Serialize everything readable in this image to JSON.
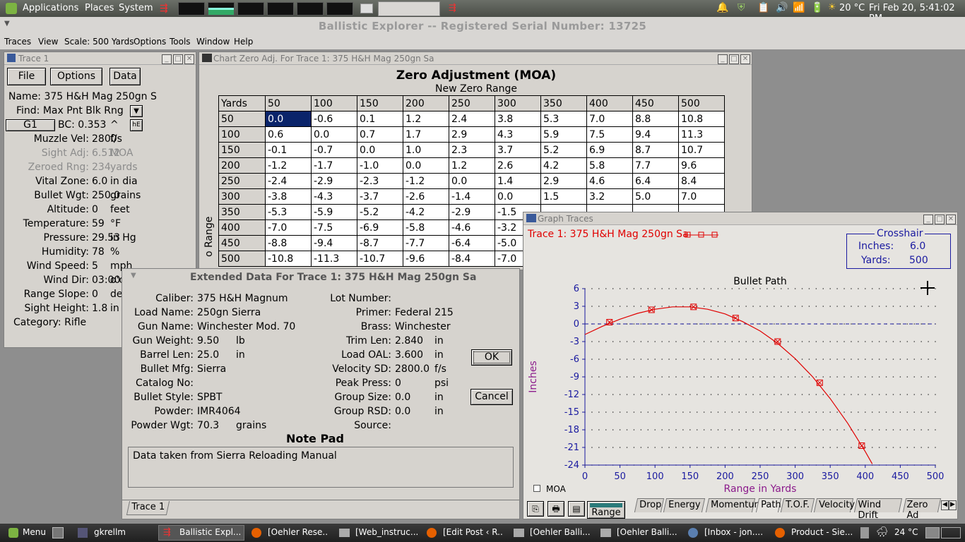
{
  "panel": {
    "applications": "Applications",
    "places": "Places",
    "system": "System",
    "temp": "20 °C",
    "clock": "Fri Feb 20,  5:41:02 PM"
  },
  "app": {
    "title": "Ballistic Explorer  --  Registered Serial Number: 13725",
    "menu": [
      "Traces",
      "View",
      "Scale: 500 Yards",
      "Options",
      "Tools",
      "Window",
      "Help"
    ]
  },
  "trace": {
    "title": "Trace 1",
    "file": "File",
    "options": "Options",
    "data": "Data",
    "name": "Name: 375 H&H Mag 250gn S",
    "find": "Find: Max Pnt Blk Rng",
    "g1": "G1",
    "bc": "BC: 0.353",
    "bc_unit": "^",
    "bc_btn": "hE",
    "fields": [
      {
        "label": "Muzzle Vel:",
        "value": "2800",
        "unit": "f/s",
        "grey": false
      },
      {
        "label": "Sight Adj:",
        "value": "6.512",
        "unit": "MOA",
        "grey": true
      },
      {
        "label": "Zeroed    Rng:",
        "value": "234",
        "unit": "yards",
        "grey": true
      },
      {
        "label": "Vital Zone:",
        "value": "6.0",
        "unit": "in dia",
        "grey": false
      },
      {
        "label": "Bullet Wgt:",
        "value": "250.0",
        "unit": "grains",
        "grey": false
      },
      {
        "label": "Altitude:",
        "value": "0",
        "unit": "feet",
        "grey": false
      },
      {
        "label": "Temperature:",
        "value": "59",
        "unit": "°F",
        "grey": false
      },
      {
        "label": "Pressure:",
        "value": "29.53",
        "unit": "in Hg",
        "grey": false
      },
      {
        "label": "Humidity:",
        "value": "78",
        "unit": "%",
        "grey": false
      },
      {
        "label": "Wind Speed:",
        "value": "5",
        "unit": "mph",
        "grey": false
      },
      {
        "label": "Wind Dir:",
        "value": "03:00",
        "unit": "o'c",
        "grey": false
      },
      {
        "label": "Range Slope:",
        "value": "0",
        "unit": "de",
        "grey": false
      },
      {
        "label": "Sight Height:",
        "value": "1.8",
        "unit": "in",
        "grey": false
      }
    ],
    "category": "Category: Rifle"
  },
  "zero": {
    "title": "Chart Zero Adj. For Trace 1:  375 H&H Mag 250gn Sa",
    "heading": "Zero Adjustment (MOA)",
    "subheading": "New Zero Range",
    "side": "o Range",
    "rows": [
      [
        "Yards",
        "50",
        "100",
        "150",
        "200",
        "250",
        "300",
        "350",
        "400",
        "450",
        "500"
      ],
      [
        "50",
        "0.0",
        "-0.6",
        "0.1",
        "1.2",
        "2.4",
        "3.8",
        "5.3",
        "7.0",
        "8.8",
        "10.8"
      ],
      [
        "100",
        "0.6",
        "0.0",
        "0.7",
        "1.7",
        "2.9",
        "4.3",
        "5.9",
        "7.5",
        "9.4",
        "11.3"
      ],
      [
        "150",
        "-0.1",
        "-0.7",
        "0.0",
        "1.0",
        "2.3",
        "3.7",
        "5.2",
        "6.9",
        "8.7",
        "10.7"
      ],
      [
        "200",
        "-1.2",
        "-1.7",
        "-1.0",
        "0.0",
        "1.2",
        "2.6",
        "4.2",
        "5.8",
        "7.7",
        "9.6"
      ],
      [
        "250",
        "-2.4",
        "-2.9",
        "-2.3",
        "-1.2",
        "0.0",
        "1.4",
        "2.9",
        "4.6",
        "6.4",
        "8.4"
      ],
      [
        "300",
        "-3.8",
        "-4.3",
        "-3.7",
        "-2.6",
        "-1.4",
        "0.0",
        "1.5",
        "3.2",
        "5.0",
        "7.0"
      ],
      [
        "350",
        "-5.3",
        "-5.9",
        "-5.2",
        "-4.2",
        "-2.9",
        "-1.5",
        "",
        "",
        "",
        ""
      ],
      [
        "400",
        "-7.0",
        "-7.5",
        "-6.9",
        "-5.8",
        "-4.6",
        "-3.2",
        "",
        "",
        "",
        ""
      ],
      [
        "450",
        "-8.8",
        "-9.4",
        "-8.7",
        "-7.7",
        "-6.4",
        "-5.0",
        "",
        "",
        "",
        ""
      ],
      [
        "500",
        "-10.8",
        "-11.3",
        "-10.7",
        "-9.6",
        "-8.4",
        "-7.0",
        "",
        "",
        "",
        ""
      ]
    ]
  },
  "ext": {
    "title": "Extended Data For Trace 1:  375 H&H Mag 250gn Sa",
    "left": [
      {
        "label": "Caliber:",
        "value": "375 H&H Magnum",
        "unit": ""
      },
      {
        "label": "Load Name:",
        "value": "250gn Sierra",
        "unit": ""
      },
      {
        "label": "Gun Name:",
        "value": "Winchester Mod. 70",
        "unit": ""
      },
      {
        "label": "Gun Weight:",
        "value": "9.50",
        "unit": "lb"
      },
      {
        "label": "Barrel Len:",
        "value": "25.0",
        "unit": "in"
      },
      {
        "label": "Bullet Mfg:",
        "value": "Sierra",
        "unit": ""
      },
      {
        "label": "Catalog No:",
        "value": "",
        "unit": ""
      },
      {
        "label": "Bullet Style:",
        "value": "SPBT",
        "unit": ""
      },
      {
        "label": "Powder:",
        "value": "IMR4064",
        "unit": ""
      },
      {
        "label": "Powder Wgt:",
        "value": "70.3",
        "unit": "grains"
      }
    ],
    "right": [
      {
        "label": "Lot Number:",
        "value": "",
        "unit": ""
      },
      {
        "label": "Primer:",
        "value": "Federal 215",
        "unit": ""
      },
      {
        "label": "Brass:",
        "value": "Winchester",
        "unit": ""
      },
      {
        "label": "Trim Len:",
        "value": "2.840",
        "unit": "in"
      },
      {
        "label": "Load OAL:",
        "value": "3.600",
        "unit": "in"
      },
      {
        "label": "Velocity SD:",
        "value": "2800.0",
        "unit": "f/s"
      },
      {
        "label": "Peak Press:",
        "value": "0",
        "unit": "psi"
      },
      {
        "label": "Group Size:",
        "value": "0.0",
        "unit": "in"
      },
      {
        "label": "Group RSD:",
        "value": "0.0",
        "unit": "in"
      },
      {
        "label": "Source:",
        "value": "",
        "unit": ""
      }
    ],
    "ok": "OK",
    "cancel": "Cancel",
    "notepad_title": "Note Pad",
    "notepad": "Data taken from Sierra Reloading Manual",
    "tab": "Trace 1"
  },
  "graph": {
    "title": "Graph Traces",
    "trace_label": "Trace 1:  375 H&H Mag 250gn Sa",
    "crosshair_title": "Crosshair",
    "inches_label": "Inches:",
    "inches": "6.0",
    "yards_label": "Yards:",
    "yards": "500",
    "moa": "MOA",
    "range_btn": "Range",
    "tabs": [
      "Drop",
      "Energy",
      "Momentum",
      "Path",
      "T.O.F.",
      "Velocity",
      "Wind Drift",
      "Zero Ad"
    ]
  },
  "chart_data": {
    "type": "line",
    "title": "Bullet Path",
    "xlabel": "Range in Yards",
    "ylabel": "Inches",
    "xlim": [
      0,
      500
    ],
    "ylim": [
      -24,
      6
    ],
    "xticks": [
      0,
      50,
      100,
      150,
      200,
      250,
      300,
      350,
      400,
      450,
      500
    ],
    "yticks": [
      6,
      3,
      0,
      -3,
      -6,
      -9,
      -12,
      -15,
      -18,
      -21,
      -24
    ],
    "series": [
      {
        "name": "Trace 1:  375 H&H Mag 250gn Sa",
        "color": "#e00000",
        "x": [
          0,
          25,
          50,
          75,
          100,
          125,
          150,
          175,
          200,
          225,
          250,
          275,
          300,
          325,
          350,
          375,
          400,
          410
        ],
        "y": [
          -1.8,
          -0.4,
          0.8,
          1.8,
          2.5,
          2.9,
          2.9,
          2.5,
          1.7,
          0.4,
          -1.2,
          -3.3,
          -5.9,
          -9.0,
          -12.7,
          -16.9,
          -21.7,
          -23.8
        ]
      }
    ],
    "markers": {
      "x": [
        35,
        95,
        155,
        215,
        275,
        335,
        395
      ],
      "y": [
        0.3,
        2.4,
        2.9,
        1.0,
        -3.0,
        -10.0,
        -20.7
      ]
    },
    "grid": true
  },
  "taskbar": {
    "menu": "Menu",
    "items": [
      "gkrellm",
      "Ballistic Expl...",
      "[Oehler Rese...",
      "[Web_instruc...",
      "[Edit Post ‹ R...",
      "[Oehler Balli...",
      "[Oehler Balli...",
      "[Inbox - jon....",
      "Product - Sie..."
    ],
    "temp": "24 °C"
  }
}
